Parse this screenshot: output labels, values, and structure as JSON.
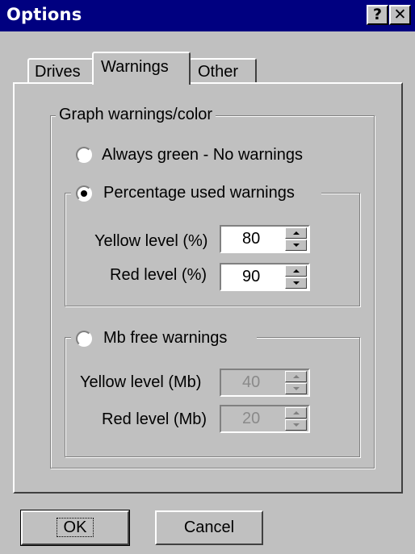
{
  "window": {
    "title": "Options",
    "help_button": "?",
    "close_button": "✕"
  },
  "tabs": [
    {
      "label": "Drives",
      "active": false
    },
    {
      "label": "Warnings",
      "active": true
    },
    {
      "label": "Other",
      "active": false
    }
  ],
  "graph_group": {
    "legend": "Graph warnings/color",
    "always_green": {
      "label": "Always green - No warnings",
      "selected": false
    }
  },
  "percentage_group": {
    "legend": "Percentage used warnings",
    "selected": true,
    "yellow": {
      "label": "Yellow level (%)",
      "value": "80"
    },
    "red": {
      "label": "Red level (%)",
      "value": "90"
    }
  },
  "mb_group": {
    "legend": "Mb free warnings",
    "selected": false,
    "yellow": {
      "label": "Yellow level (Mb)",
      "value": "40"
    },
    "red": {
      "label": "Red level (Mb)",
      "value": "20"
    }
  },
  "buttons": {
    "ok": "OK",
    "cancel": "Cancel"
  }
}
